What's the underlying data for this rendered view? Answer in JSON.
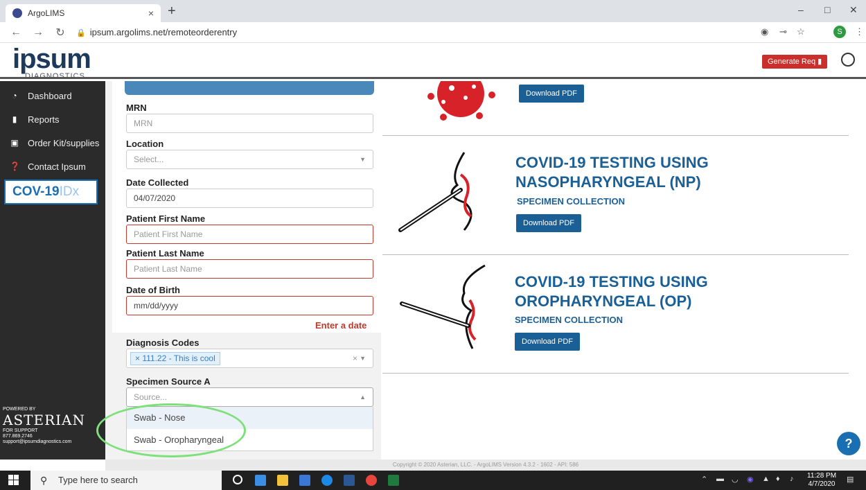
{
  "browser": {
    "tab_title": "ArgoLIMS",
    "tab_close": "×",
    "new_tab": "+",
    "url": "ipsum.argolims.net/remoteorderentry",
    "profile_initial": "S"
  },
  "header": {
    "logo_big": "ipsum",
    "logo_small": "DIAGNOSTICS",
    "generate_req": "Generate Req"
  },
  "sidebar": {
    "items": [
      {
        "label": "Dashboard",
        "icon": "dashboard-icon"
      },
      {
        "label": "Reports",
        "icon": "file-icon"
      },
      {
        "label": "Order Kit/supplies",
        "icon": "briefcase-icon"
      },
      {
        "label": "Contact Ipsum",
        "icon": "question-icon"
      }
    ],
    "badge_main": "COV-19",
    "badge_idx": "IDx",
    "powered_by": "POWERED BY",
    "powered_brand": "ASTERIAN",
    "support_label": "FOR SUPPORT",
    "support_phone": "877.869.2746",
    "support_email": "support@ipsumdiagnostics.com"
  },
  "form": {
    "mrn_label": "MRN",
    "mrn_placeholder": "MRN",
    "location_label": "Location",
    "location_placeholder": "Select...",
    "date_collected_label": "Date Collected",
    "date_collected_value": "04/07/2020",
    "first_name_label": "Patient First Name",
    "first_name_placeholder": "Patient First Name",
    "last_name_label": "Patient Last Name",
    "last_name_placeholder": "Patient Last Name",
    "dob_label": "Date of Birth",
    "dob_placeholder": "mm/dd/yyyy",
    "dob_error": "Enter a date",
    "diagnosis_label": "Diagnosis Codes",
    "diagnosis_tag": "111.22 - This is cool",
    "specimen_label": "Specimen Source A",
    "specimen_placeholder": "Source...",
    "specimen_options": [
      "Swab - Nose",
      "Swab - Oropharyngeal"
    ]
  },
  "cards": {
    "top_download": "Download PDF",
    "np_title_1": "COVID-19 TESTING USING",
    "np_title_2": "NASOPHARYNGEAL (NP)",
    "np_sub": "SPECIMEN COLLECTION",
    "np_download": "Download PDF",
    "op_title_1": "COVID-19 TESTING USING",
    "op_title_2": "OROPHARYNGEAL (OP)",
    "op_sub": "SPECIMEN COLLECTION",
    "op_download": "Download PDF"
  },
  "footer": "Copyright © 2020 Asterian, LLC. - ArgoLIMS Version 4.3.2 - 1602 - API: 586",
  "help": "?",
  "taskbar": {
    "search": "Type here to search",
    "time": "11:28 PM",
    "date": "4/7/2020"
  },
  "colors": {
    "brand_blue": "#1a5f96",
    "error_red": "#c0392b",
    "highlight_green": "#7ee07a",
    "sidebar_bg": "#2b2b2b"
  }
}
